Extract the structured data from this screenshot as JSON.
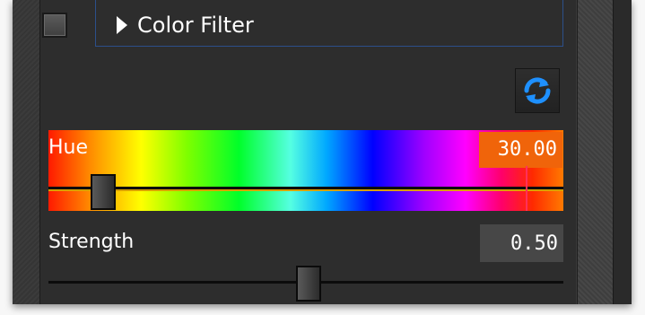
{
  "section": {
    "title": "Color Filter",
    "enabled": false
  },
  "hue": {
    "label": "Hue",
    "value": "30.00",
    "slider_fraction": 0.11,
    "value_box_color": "#f0640a"
  },
  "strength": {
    "label": "Strength",
    "value": "0.50",
    "slider_fraction": 0.5
  },
  "icons": {
    "reset": "refresh-icon",
    "expand": "triangle-right-icon"
  },
  "colors": {
    "header_border": "#2c4f8a",
    "panel_bg": "#2d2d2d",
    "reset_icon": "#1e90ff"
  }
}
